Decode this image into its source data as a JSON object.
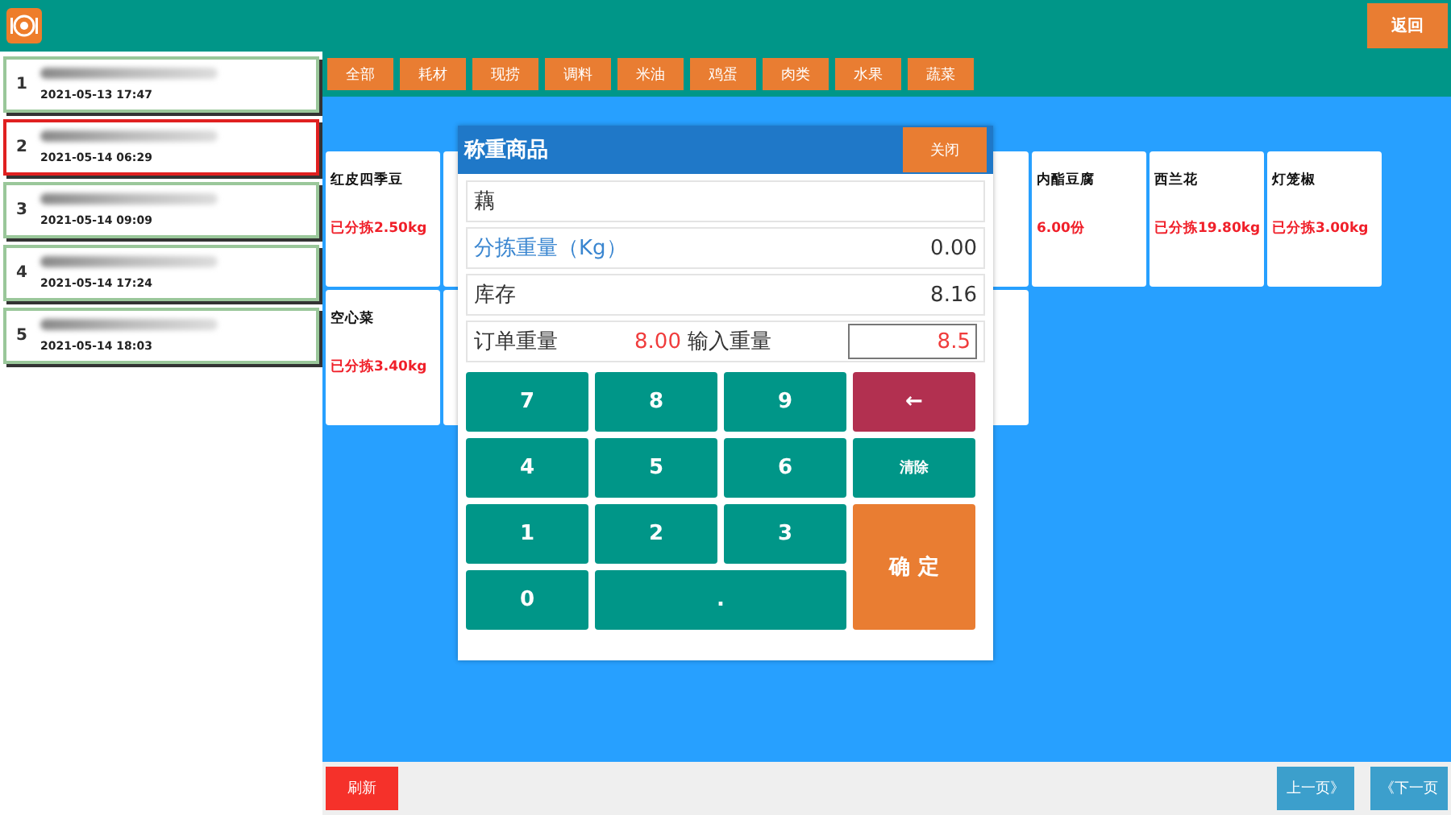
{
  "header": {
    "back_button": "返回"
  },
  "orders": [
    {
      "number": "1",
      "date": "2021-05-13 17:47",
      "selected": false
    },
    {
      "number": "2",
      "date": "2021-05-14 06:29",
      "selected": true
    },
    {
      "number": "3",
      "date": "2021-05-14 09:09",
      "selected": false
    },
    {
      "number": "4",
      "date": "2021-05-14 17:24",
      "selected": false
    },
    {
      "number": "5",
      "date": "2021-05-14 18:03",
      "selected": false
    }
  ],
  "categories": [
    "全部",
    "耗材",
    "现捞",
    "调料",
    "米油",
    "鸡蛋",
    "肉类",
    "水果",
    "蔬菜"
  ],
  "product_rows": [
    [
      {
        "kind": "product",
        "name": "红皮四季豆",
        "status": "已分拣2.50kg"
      },
      {
        "kind": "product"
      },
      {
        "kind": "covered"
      },
      {
        "kind": "covered"
      },
      {
        "kind": "covered"
      },
      {
        "kind": "product"
      },
      {
        "kind": "product",
        "name": "内酯豆腐",
        "status": "6.00份"
      },
      {
        "kind": "product",
        "name": "西兰花",
        "status": "已分拣19.80kg"
      },
      {
        "kind": "product",
        "name": "灯笼椒",
        "status": "已分拣3.00kg"
      }
    ],
    [
      {
        "kind": "product",
        "name": "空心菜",
        "status": "已分拣3.40kg"
      },
      {
        "kind": "product"
      },
      {
        "kind": "covered"
      },
      {
        "kind": "covered"
      },
      {
        "kind": "covered"
      },
      {
        "kind": "product"
      }
    ]
  ],
  "dialog": {
    "title": "称重商品",
    "close_button": "关闭",
    "product": "藕",
    "sorted_weight": {
      "label": "分拣重量（Kg）",
      "value": "0.00"
    },
    "stock": {
      "label": "库存",
      "value": "8.16"
    },
    "order_weight": {
      "label": "订单重量",
      "value": "8.00"
    },
    "input_weight": {
      "label": "输入重量",
      "value": "8.5"
    },
    "keys": [
      {
        "label": "7",
        "kind": "digit"
      },
      {
        "label": "8",
        "kind": "digit"
      },
      {
        "label": "9",
        "kind": "digit"
      },
      {
        "label": "←",
        "kind": "backspace"
      },
      {
        "label": "4",
        "kind": "digit"
      },
      {
        "label": "5",
        "kind": "digit"
      },
      {
        "label": "6",
        "kind": "digit"
      },
      {
        "label": "清除",
        "kind": "clear"
      },
      {
        "label": "1",
        "kind": "digit"
      },
      {
        "label": "2",
        "kind": "digit"
      },
      {
        "label": "3",
        "kind": "digit"
      },
      {
        "label": "确 定",
        "kind": "confirm"
      },
      {
        "label": "0",
        "kind": "digit"
      },
      {
        "label": ".",
        "kind": "dot"
      }
    ]
  },
  "footer": {
    "refresh_button": "刷新",
    "prev_button": "上一页》",
    "next_button": "《下一页"
  }
}
